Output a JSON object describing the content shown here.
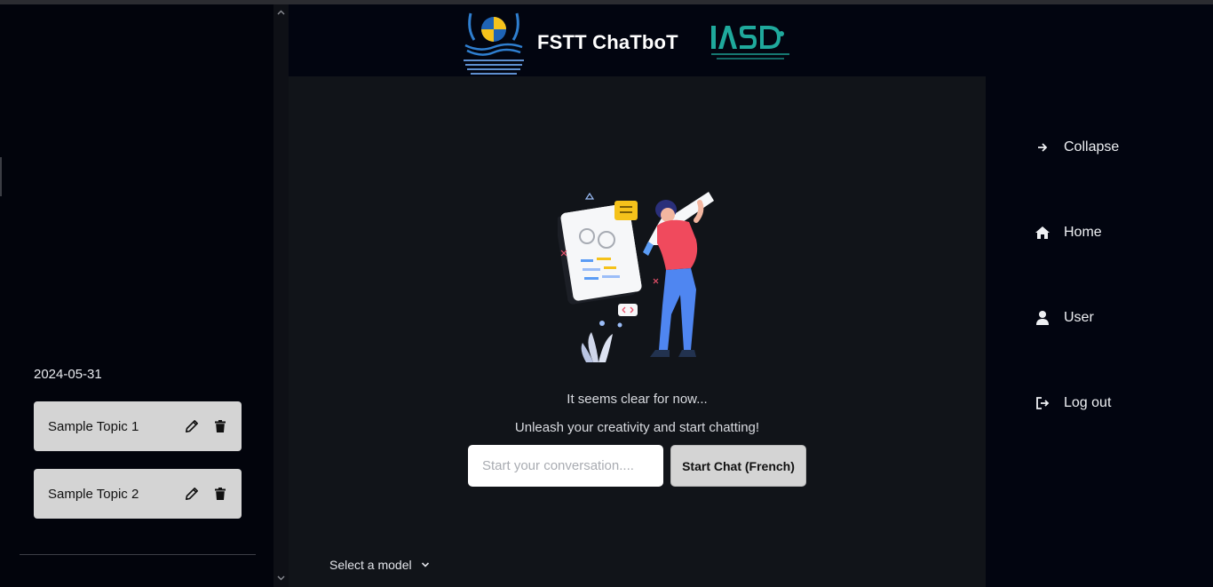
{
  "app": {
    "title": "FSTT ChaTboT"
  },
  "sidebar": {
    "date": "2024-05-31",
    "topics": [
      {
        "name": "Sample Topic 1"
      },
      {
        "name": "Sample Topic 2"
      }
    ]
  },
  "main": {
    "empty_title": "It seems clear for now...",
    "empty_subtitle": "Unleash your creativity and start chatting!",
    "input_placeholder": "Start your conversation....",
    "start_button": "Start Chat (French)",
    "model_select": "Select a model"
  },
  "nav": {
    "items": [
      {
        "label": "Collapse",
        "icon": "arrow-right-icon"
      },
      {
        "label": "Home",
        "icon": "home-icon"
      },
      {
        "label": "User",
        "icon": "user-icon"
      },
      {
        "label": "Log out",
        "icon": "logout-icon"
      }
    ]
  },
  "colors": {
    "background": "#020510",
    "panel": "#111419",
    "topic_card": "#d4d4d4",
    "accent_teal": "#1fa99c",
    "accent_yellow": "#f5c21b"
  }
}
